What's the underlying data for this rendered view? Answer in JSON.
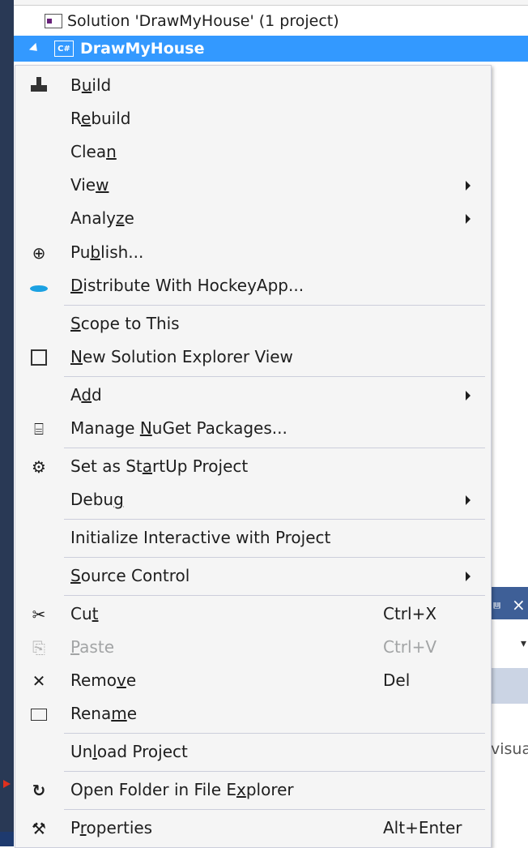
{
  "tree": {
    "solution_label": "Solution 'DrawMyHouse' (1 project)",
    "project_icon": "C#",
    "project_label": "DrawMyHouse"
  },
  "background": {
    "pin_glyph": "⩏",
    "close_glyph": "×",
    "dropdown_glyph": "▾",
    "partial_text": "visua"
  },
  "menu": {
    "items": [
      {
        "id": "build",
        "pre": "B",
        "ul": "u",
        "post": "ild",
        "icon": "build-icon",
        "glyph": "",
        "shortcut": "",
        "submenu": false,
        "enabled": true
      },
      {
        "id": "rebuild",
        "pre": "R",
        "ul": "e",
        "post": "build",
        "icon": "",
        "glyph": "",
        "shortcut": "",
        "submenu": false,
        "enabled": true
      },
      {
        "id": "clean",
        "pre": "Clea",
        "ul": "n",
        "post": "",
        "icon": "",
        "glyph": "",
        "shortcut": "",
        "submenu": false,
        "enabled": true
      },
      {
        "id": "view",
        "pre": "Vie",
        "ul": "w",
        "post": "",
        "icon": "",
        "glyph": "",
        "shortcut": "",
        "submenu": true,
        "enabled": true
      },
      {
        "id": "analyze",
        "pre": "Analy",
        "ul": "z",
        "post": "e",
        "icon": "",
        "glyph": "",
        "shortcut": "",
        "submenu": true,
        "enabled": true
      },
      {
        "id": "publish",
        "pre": "Pu",
        "ul": "b",
        "post": "lish...",
        "icon": "globe-icon",
        "glyph": "⊕",
        "shortcut": "",
        "submenu": false,
        "enabled": true
      },
      {
        "id": "distribute",
        "pre": "",
        "ul": "D",
        "post": "istribute With HockeyApp...",
        "icon": "hockeyapp-icon",
        "glyph": "",
        "shortcut": "",
        "submenu": false,
        "enabled": true
      },
      {
        "id": "scope",
        "pre": "",
        "ul": "S",
        "post": "cope to This",
        "icon": "",
        "glyph": "",
        "shortcut": "",
        "submenu": false,
        "enabled": true
      },
      {
        "id": "new-view",
        "pre": "",
        "ul": "N",
        "post": "ew Solution Explorer View",
        "icon": "new-solution-view-icon",
        "glyph": "",
        "shortcut": "",
        "submenu": false,
        "enabled": true
      },
      {
        "id": "add",
        "pre": "A",
        "ul": "d",
        "post": "d",
        "icon": "",
        "glyph": "",
        "shortcut": "",
        "submenu": true,
        "enabled": true
      },
      {
        "id": "nuget",
        "pre": "Manage ",
        "ul": "N",
        "post": "uGet Packages...",
        "icon": "nuget-icon",
        "glyph": "⌸",
        "shortcut": "",
        "submenu": false,
        "enabled": true
      },
      {
        "id": "startup",
        "pre": "Set as St",
        "ul": "a",
        "post": "rtUp Project",
        "icon": "gear-icon",
        "glyph": "⚙",
        "shortcut": "",
        "submenu": false,
        "enabled": true
      },
      {
        "id": "debug",
        "pre": "Debu",
        "ul": "g",
        "post": "",
        "icon": "",
        "glyph": "",
        "shortcut": "",
        "submenu": true,
        "enabled": true
      },
      {
        "id": "interactive",
        "pre": "Initialize Interactive with Project",
        "ul": "",
        "post": "",
        "icon": "",
        "glyph": "",
        "shortcut": "",
        "submenu": false,
        "enabled": true
      },
      {
        "id": "source-control",
        "pre": "",
        "ul": "S",
        "post": "ource Control",
        "icon": "",
        "glyph": "",
        "shortcut": "",
        "submenu": true,
        "enabled": true
      },
      {
        "id": "cut",
        "pre": "Cu",
        "ul": "t",
        "post": "",
        "icon": "scissors-icon",
        "glyph": "✂",
        "shortcut": "Ctrl+X",
        "submenu": false,
        "enabled": true
      },
      {
        "id": "paste",
        "pre": "",
        "ul": "P",
        "post": "aste",
        "icon": "clipboard-icon",
        "glyph": "⎘",
        "shortcut": "Ctrl+V",
        "submenu": false,
        "enabled": false
      },
      {
        "id": "remove",
        "pre": "Remo",
        "ul": "v",
        "post": "e",
        "icon": "remove-x-icon",
        "glyph": "✕",
        "shortcut": "Del",
        "submenu": false,
        "enabled": true
      },
      {
        "id": "rename",
        "pre": "Rena",
        "ul": "m",
        "post": "e",
        "icon": "rename-icon",
        "glyph": "",
        "shortcut": "",
        "submenu": false,
        "enabled": true
      },
      {
        "id": "unload",
        "pre": "Un",
        "ul": "l",
        "post": "oad Project",
        "icon": "",
        "glyph": "",
        "shortcut": "",
        "submenu": false,
        "enabled": true
      },
      {
        "id": "open-folder",
        "pre": "Open Folder in File E",
        "ul": "x",
        "post": "plorer",
        "icon": "open-folder-arrow-icon",
        "glyph": "↻",
        "shortcut": "",
        "submenu": false,
        "enabled": true
      },
      {
        "id": "properties",
        "pre": "P",
        "ul": "r",
        "post": "operties",
        "icon": "wrench-icon",
        "glyph": "⚒",
        "shortcut": "Alt+Enter",
        "submenu": false,
        "enabled": true
      }
    ]
  }
}
